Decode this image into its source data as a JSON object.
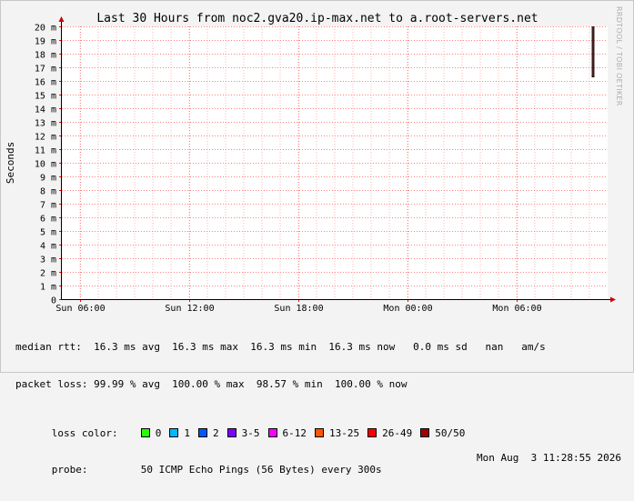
{
  "watermark": "RRDTOOL / TOBI OETIKER",
  "chart_data": {
    "type": "line",
    "title": "Last 30 Hours from noc2.gva20.ip-max.net to a.root-servers.net",
    "ylabel": "Seconds",
    "xlabel": "",
    "y_unit_suffix": "m",
    "ylim": [
      0,
      20
    ],
    "y_ticks": [
      0,
      1,
      2,
      3,
      4,
      5,
      6,
      7,
      8,
      9,
      10,
      11,
      12,
      13,
      14,
      15,
      16,
      17,
      18,
      19,
      20
    ],
    "y_tick_labels": [
      "0",
      "1 m",
      "2 m",
      "3 m",
      "4 m",
      "5 m",
      "6 m",
      "7 m",
      "8 m",
      "9 m",
      "10 m",
      "11 m",
      "12 m",
      "13 m",
      "14 m",
      "15 m",
      "16 m",
      "17 m",
      "18 m",
      "19 m",
      "20 m"
    ],
    "xlim_hours": [
      0,
      30
    ],
    "x_ticks": [
      {
        "label": "Sun 06:00",
        "hour": 1
      },
      {
        "label": "Sun 12:00",
        "hour": 7
      },
      {
        "label": "Sun 18:00",
        "hour": 13
      },
      {
        "label": "Mon 00:00",
        "hour": 19
      },
      {
        "label": "Mon 06:00",
        "hour": 25
      }
    ],
    "grid": true,
    "series": [
      {
        "x_hour": 29.2,
        "y_from": 16.3,
        "y_to": 20,
        "color": "#3b1d1d"
      }
    ]
  },
  "legend": {
    "median_rtt": "median rtt:  16.3 ms avg  16.3 ms max  16.3 ms min  16.3 ms now   0.0 ms sd   nan   am/s",
    "packet_loss": "packet loss: 99.99 % avg  100.00 % max  98.57 % min  100.00 % now",
    "loss_color_label": "loss color:",
    "loss_colors": [
      {
        "label": "0",
        "color": "#26ff00"
      },
      {
        "label": "1",
        "color": "#00b8ff"
      },
      {
        "label": "2",
        "color": "#0059ff"
      },
      {
        "label": "3-5",
        "color": "#7e00ff"
      },
      {
        "label": "6-12",
        "color": "#ff00ff"
      },
      {
        "label": "13-25",
        "color": "#ff5500"
      },
      {
        "label": "26-49",
        "color": "#ff0000"
      },
      {
        "label": "50/50",
        "color": "#a10000"
      }
    ],
    "probe_label": "probe:",
    "probe": "50 ICMP Echo Pings (56 Bytes) every 300s",
    "timestamp": "Mon Aug  3 11:28:55 2026"
  }
}
